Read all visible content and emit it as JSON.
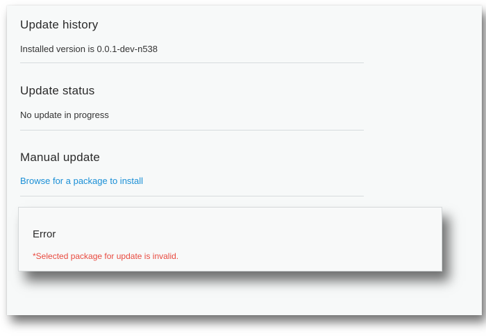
{
  "update_history": {
    "title": "Update history",
    "text": "Installed version is 0.0.1-dev-n538"
  },
  "update_status": {
    "title": "Update status",
    "text": "No update in progress"
  },
  "manual_update": {
    "title": "Manual update",
    "link": "Browse for a package to install"
  },
  "error_dialog": {
    "title": "Error",
    "message": "*Selected package for update is invalid."
  },
  "colors": {
    "link": "#1a8fd6",
    "error": "#e84a3f",
    "panel_background": "#f7f9f9"
  }
}
